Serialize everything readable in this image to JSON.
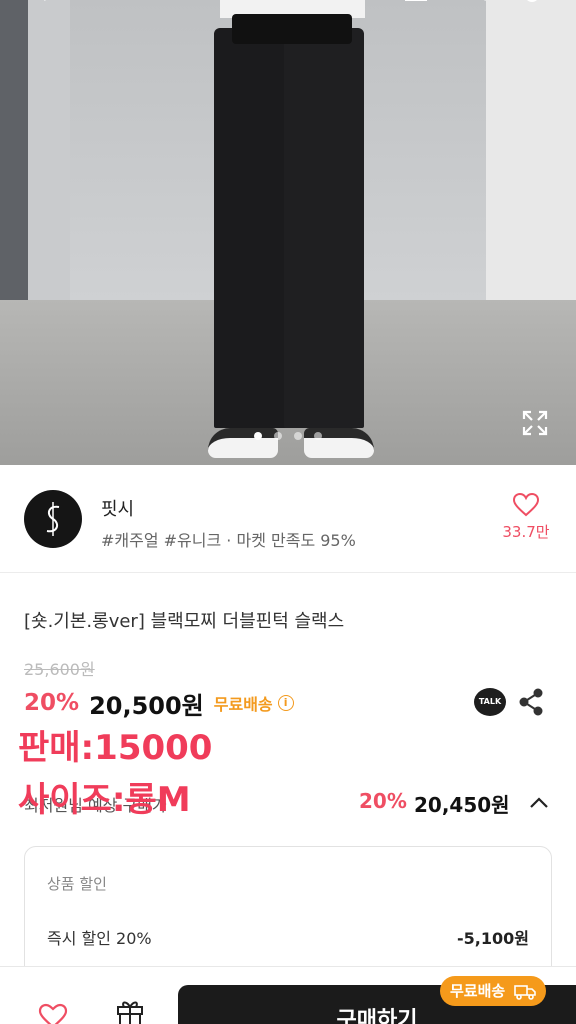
{
  "seller": {
    "name": "핏시",
    "tags": "#캐주얼 #유니크 · 마켓 만족도 95%",
    "likes": "33.7만"
  },
  "product": {
    "title": "[숏.기본.롱ver] 블랙모찌 더블핀턱 슬랙스",
    "original_price": "25,600원",
    "discount": "20%",
    "price": "20,500원",
    "shipping": "무료배송",
    "talk_label": "TALK"
  },
  "overlay": {
    "line1": "판매:15000",
    "line2": "사이즈:롱M"
  },
  "lowest": {
    "label": "최저원님 예상 구매가",
    "discount": "20%",
    "price": "20,450원"
  },
  "discount_box": {
    "title": "상품 할인",
    "item_label": "즉시 할인 20%",
    "item_value": "-5,100원"
  },
  "bottom": {
    "buy_label": "구매하기",
    "ship_badge": "무료배송"
  },
  "colors": {
    "accent": "#ef4e63",
    "shipping": "#f39a1e",
    "button": "#1b1b1b"
  },
  "carousel": {
    "current": 1,
    "total": 4
  }
}
